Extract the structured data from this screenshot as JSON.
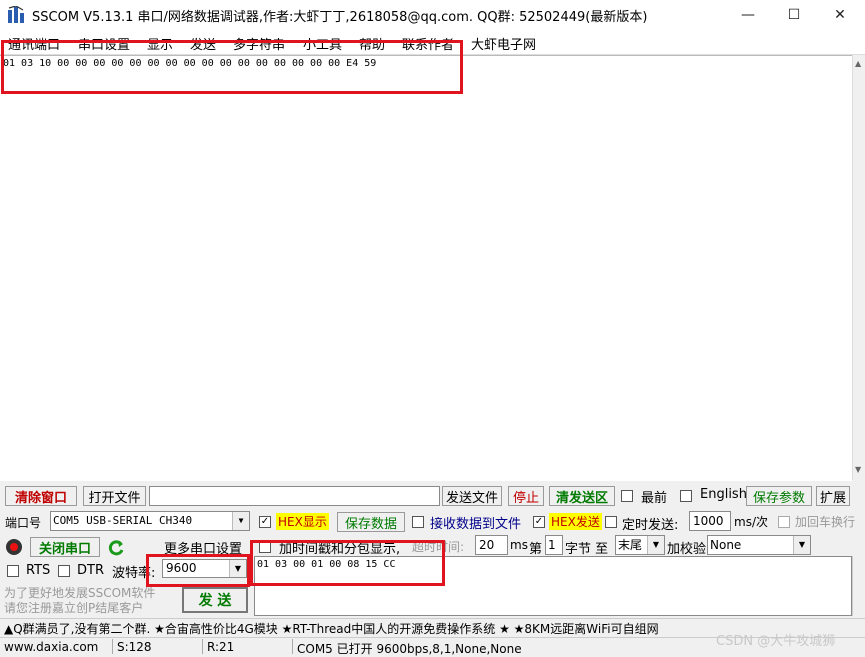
{
  "window": {
    "title": "SSCOM V5.13.1 串口/网络数据调试器,作者:大虾丁丁,2618058@qq.com. QQ群: 52502449(最新版本)",
    "controls": [
      "—",
      "☐",
      "✕"
    ]
  },
  "menu": [
    "通讯端口",
    "串口设置",
    "显示",
    "发送",
    "多字符串",
    "小工具",
    "帮助",
    "联系作者",
    "大虾电子网"
  ],
  "receive": {
    "text": "01 03 10 00 00 00 00 00 00 00 00 00 00 00 00 00 00 00 00 E4 59"
  },
  "toolbar": {
    "clear": "清除窗口",
    "open_file": "打开文件",
    "file_path": "",
    "send_file": "发送文件",
    "stop": "停止",
    "clear_send": "清发送区",
    "topmost": "最前",
    "english": "English",
    "save_params": "保存参数",
    "expand": "扩展"
  },
  "port": {
    "port_label": "端口号",
    "port_value": "COM5 USB-SERIAL CH340",
    "close_port": "关闭串口",
    "more_settings": "更多串口设置",
    "rts": "RTS",
    "dtr": "DTR",
    "baud_label": "波特率:",
    "baud_value": "9600"
  },
  "options": {
    "hex_display": "HEX显示",
    "hex_display_checked": true,
    "save_data": "保存数据",
    "recv_to_file": "接收数据到文件",
    "hex_send": "HEX发送",
    "hex_send_checked": true,
    "timed_send": "定时发送:",
    "interval": "1000",
    "interval_unit": "ms/次",
    "add_crlf": "加回车换行",
    "timestamp": "加时间戳和分包显示,",
    "timeout_label": "超时时间:",
    "timeout_value": "20",
    "timeout_unit": "ms",
    "byte_index_label": "第",
    "byte_index": "1",
    "byte_unit": "字节 至",
    "end_value": "末尾",
    "checksum_label": "加校验",
    "checksum_value": "None"
  },
  "send": {
    "text": "01 03 00 01 00 08 15 CC",
    "button": "发 送"
  },
  "promo": [
    "为了更好地发展SSCOM软件",
    "请您注册嘉立创P结尾客户"
  ],
  "ad": "▲Q群满员了,没有第二个群. ★合宙高性价比4G模块 ★RT-Thread中国人的开源免费操作系统 ★ ★8KM远距离WiFi可自组网",
  "status": {
    "website": "www.daxia.com",
    "sent": "S:128",
    "received": "R:21",
    "port_state": "COM5 已打开  9600bps,8,1,None,None"
  },
  "watermark": "CSDN @大牛攻城狮"
}
